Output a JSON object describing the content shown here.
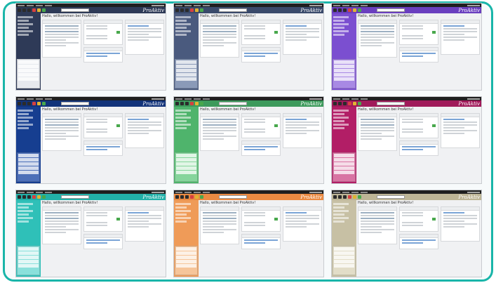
{
  "brand": "ProAktiv",
  "welcome": "Hallo, willkommen bei ProAktiv!",
  "themes": [
    {
      "name": "default",
      "toolbar": "#2e3a57",
      "sidebar": "#2e3a57",
      "panel": "#e6e9ee"
    },
    {
      "name": "slate",
      "toolbar": "#3a4a6b",
      "sidebar": "#4a5a7e",
      "panel": "#8a9ab8"
    },
    {
      "name": "purple",
      "toolbar": "#6a3fbf",
      "sidebar": "#7b4fd0",
      "panel": "#a889e4"
    },
    {
      "name": "navy",
      "toolbar": "#12337a",
      "sidebar": "#163e90",
      "panel": "#4c6fb8"
    },
    {
      "name": "green",
      "toolbar": "#3d9a5c",
      "sidebar": "#4fb46c",
      "panel": "#86d59c"
    },
    {
      "name": "magenta",
      "toolbar": "#a01a5a",
      "sidebar": "#b21e66",
      "panel": "#d874a3"
    },
    {
      "name": "teal",
      "toolbar": "#22b0a8",
      "sidebar": "#2fc0b8",
      "panel": "#8ae0db"
    },
    {
      "name": "orange",
      "toolbar": "#ea8a42",
      "sidebar": "#ef9b58",
      "panel": "#f6c59a"
    },
    {
      "name": "sand",
      "toolbar": "#bdb596",
      "sidebar": "#c7c0a4",
      "panel": "#e2ddc8"
    }
  ]
}
